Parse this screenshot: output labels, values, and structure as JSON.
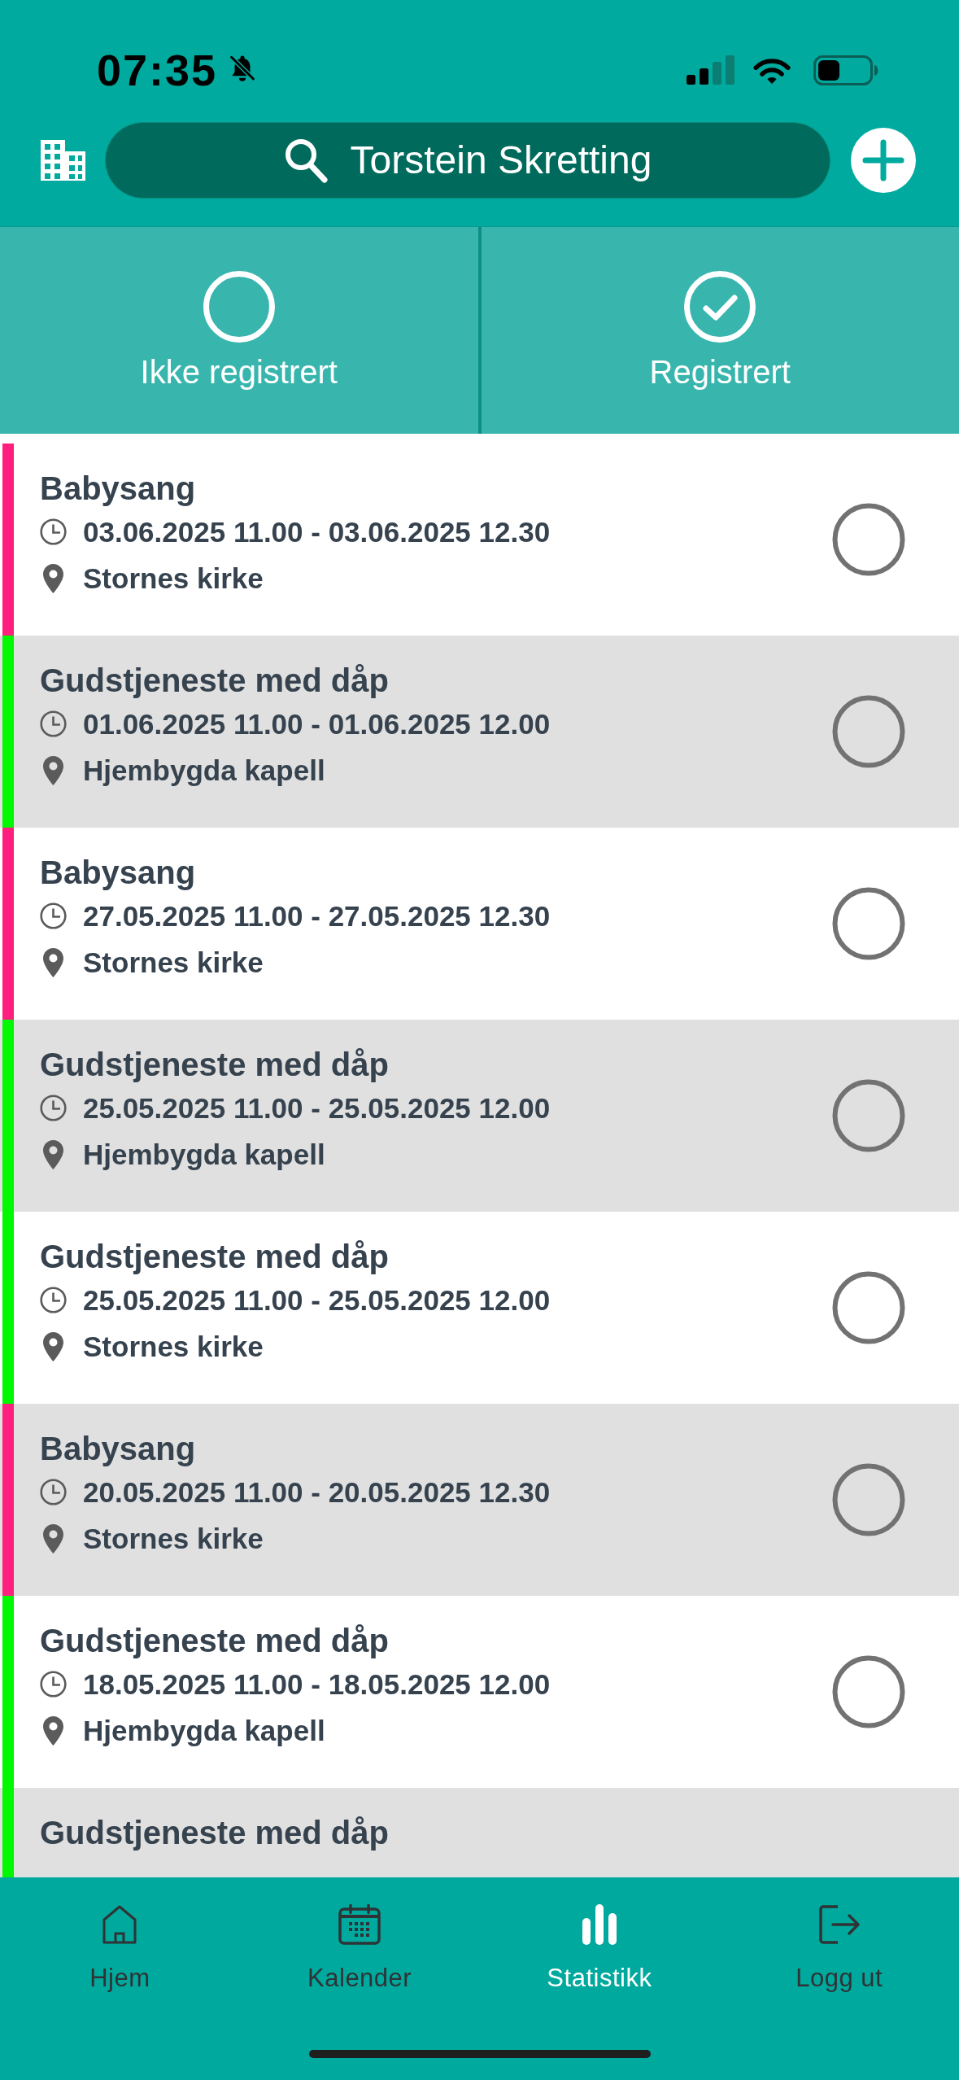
{
  "status_bar": {
    "time": "07:35"
  },
  "header": {
    "search": {
      "value": "Torstein Skretting"
    }
  },
  "filter_tabs": [
    {
      "label": "Ikke registrert",
      "kind": "unregistered"
    },
    {
      "label": "Registrert",
      "kind": "registered"
    }
  ],
  "events": [
    {
      "title": "Babysang",
      "time": "03.06.2025 11.00 - 03.06.2025 12.30",
      "location": "Stornes kirke",
      "color": "#ff1f7f",
      "registered": false
    },
    {
      "title": "Gudstjeneste med dåp",
      "time": "01.06.2025 11.00 - 01.06.2025 12.00",
      "location": "Hjembygda kapell",
      "color": "#00f800",
      "registered": false
    },
    {
      "title": "Babysang",
      "time": "27.05.2025 11.00 - 27.05.2025 12.30",
      "location": "Stornes kirke",
      "color": "#ff1f7f",
      "registered": false
    },
    {
      "title": "Gudstjeneste med dåp",
      "time": "25.05.2025 11.00 - 25.05.2025 12.00",
      "location": "Hjembygda kapell",
      "color": "#00f800",
      "registered": false
    },
    {
      "title": "Gudstjeneste med dåp",
      "time": "25.05.2025 11.00 - 25.05.2025 12.00",
      "location": "Stornes kirke",
      "color": "#00f800",
      "registered": false
    },
    {
      "title": "Babysang",
      "time": "20.05.2025 11.00 - 20.05.2025 12.30",
      "location": "Stornes kirke",
      "color": "#ff1f7f",
      "registered": false
    },
    {
      "title": "Gudstjeneste med dåp",
      "time": "18.05.2025 11.00 - 18.05.2025 12.00",
      "location": "Hjembygda kapell",
      "color": "#00f800",
      "registered": false
    },
    {
      "title": "Gudstjeneste med dåp",
      "color": "#00f800"
    }
  ],
  "bottom_nav": [
    {
      "label": "Hjem",
      "kind": "home",
      "selected": false
    },
    {
      "label": "Kalender",
      "kind": "calendar",
      "selected": false
    },
    {
      "label": "Statistikk",
      "kind": "stats",
      "selected": true
    },
    {
      "label": "Logg ut",
      "kind": "logout",
      "selected": false
    }
  ]
}
